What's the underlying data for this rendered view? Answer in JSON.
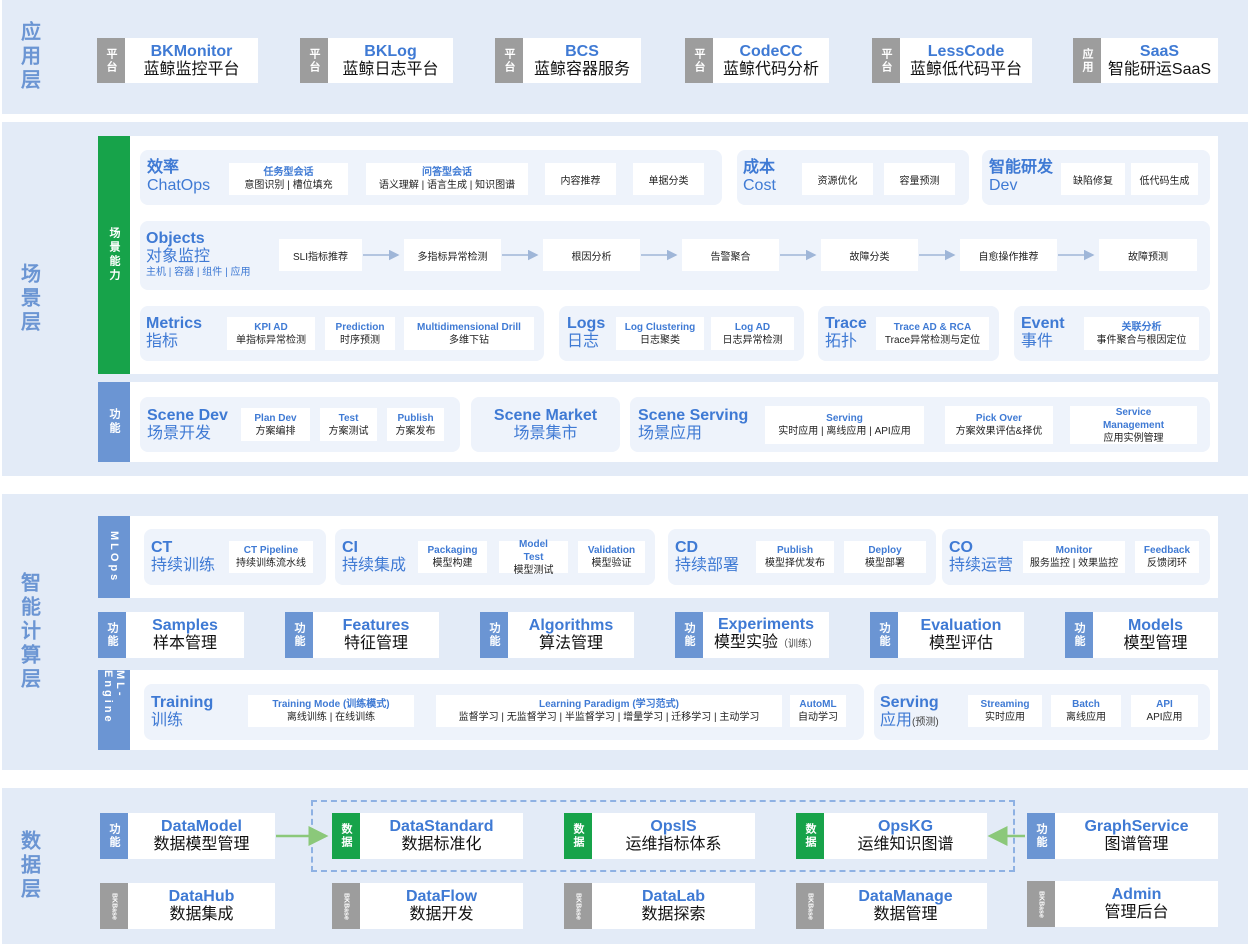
{
  "layers": {
    "app": "应用层",
    "scene": "场景层",
    "ai": "智能计算层",
    "data": "数据层"
  },
  "app_cards": [
    {
      "tag": "平台",
      "en": "BKMonitor",
      "zh": "蓝鲸监控平台"
    },
    {
      "tag": "平台",
      "en": "BKLog",
      "zh": "蓝鲸日志平台"
    },
    {
      "tag": "平台",
      "en": "BCS",
      "zh": "蓝鲸容器服务"
    },
    {
      "tag": "平台",
      "en": "CodeCC",
      "zh": "蓝鲸代码分析"
    },
    {
      "tag": "平台",
      "en": "LessCode",
      "zh": "蓝鲸低代码平台"
    },
    {
      "tag": "应用",
      "en": "SaaS",
      "zh": "智能研运SaaS"
    }
  ],
  "scene": {
    "sidebar_top": "场景能力",
    "sidebar_bottom": "功能",
    "efficiency": {
      "title_zh": "效率",
      "title_en": "ChatOps",
      "items": [
        {
          "t1": "任务型会话",
          "t2": "意图识别 | 槽位填充"
        },
        {
          "t1": "问答型会话",
          "t2": "语义理解 | 语言生成 | 知识图谱"
        },
        {
          "one": "内容推荐"
        },
        {
          "one": "单据分类"
        }
      ]
    },
    "cost": {
      "title_zh": "成本",
      "title_en": "Cost",
      "items": [
        "资源优化",
        "容量预测"
      ]
    },
    "dev": {
      "title_zh": "智能研发",
      "title_en": "Dev",
      "items": [
        "缺陷修复",
        "低代码生成"
      ]
    },
    "objects": {
      "title_en": "Objects",
      "title_zh": "对象监控",
      "sub": "主机 | 容器 | 组件 | 应用",
      "steps": [
        "SLI指标推荐",
        "多指标异常检测",
        "根因分析",
        "告警聚合",
        "故障分类",
        "自愈操作推荐",
        "故障预测"
      ]
    },
    "metrics": {
      "title_en": "Metrics",
      "title_zh": "指标",
      "items": [
        {
          "t1": "KPI AD",
          "t2": "单指标异常检测"
        },
        {
          "t1": "Prediction",
          "t2": "时序预测"
        },
        {
          "t1": "Multidimensional Drill",
          "t2": "多维下钻"
        }
      ]
    },
    "logs": {
      "title_en": "Logs",
      "title_zh": "日志",
      "items": [
        {
          "t1": "Log Clustering",
          "t2": "日志聚类"
        },
        {
          "t1": "Log AD",
          "t2": "日志异常检测"
        }
      ]
    },
    "trace": {
      "title_en": "Trace",
      "title_zh": "拓扑",
      "item": {
        "t1": "Trace AD & RCA",
        "t2": "Trace异常检测与定位"
      }
    },
    "event": {
      "title_en": "Event",
      "title_zh": "事件",
      "item": {
        "t1": "关联分析",
        "t2": "事件聚合与根因定位"
      }
    },
    "scene_dev": {
      "title_en": "Scene Dev",
      "title_zh": "场景开发",
      "items": [
        {
          "t1": "Plan Dev",
          "t2": "方案编排"
        },
        {
          "t1": "Test",
          "t2": "方案测试"
        },
        {
          "t1": "Publish",
          "t2": "方案发布"
        }
      ]
    },
    "scene_market": {
      "title_en": "Scene Market",
      "title_zh": "场景集市"
    },
    "scene_serving": {
      "title_en": "Scene Serving",
      "title_zh": "场景应用",
      "items": [
        {
          "t1": "Serving",
          "t2": "实时应用 | 离线应用 | API应用"
        },
        {
          "t1": "Pick Over",
          "t2": "方案效果评估&择优"
        },
        {
          "t1": "Service Management",
          "t2": "应用实例管理"
        }
      ]
    }
  },
  "ai": {
    "sidebar_mlops": "MLOps",
    "sidebar_func": "功能",
    "sidebar_engine": "ML-Engine",
    "ct": {
      "title_en": "CT",
      "title_zh": "持续训练",
      "items": [
        {
          "t1": "CT Pipeline",
          "t2": "持续训练流水线"
        }
      ]
    },
    "ci": {
      "title_en": "CI",
      "title_zh": "持续集成",
      "items": [
        {
          "t1": "Packaging",
          "t2": "模型构建"
        },
        {
          "t1": "Model Test",
          "t2": "模型测试"
        },
        {
          "t1": "Validation",
          "t2": "模型验证"
        }
      ]
    },
    "cd": {
      "title_en": "CD",
      "title_zh": "持续部署",
      "items": [
        {
          "t1": "Publish",
          "t2": "模型择优发布"
        },
        {
          "t1": "Deploy",
          "t2": "模型部署"
        }
      ]
    },
    "co": {
      "title_en": "CO",
      "title_zh": "持续运营",
      "items": [
        {
          "t1": "Monitor",
          "t2": "服务监控 | 效果监控"
        },
        {
          "t1": "Feedback",
          "t2": "反馈闭环"
        }
      ]
    },
    "func_cards": [
      {
        "tag": "功能",
        "en": "Samples",
        "zh": "样本管理",
        "note": ""
      },
      {
        "tag": "功能",
        "en": "Features",
        "zh": "特征管理",
        "note": ""
      },
      {
        "tag": "功能",
        "en": "Algorithms",
        "zh": "算法管理",
        "note": ""
      },
      {
        "tag": "功能",
        "en": "Experiments",
        "zh": "模型实验",
        "note": "（训练）"
      },
      {
        "tag": "功能",
        "en": "Evaluation",
        "zh": "模型评估",
        "note": ""
      },
      {
        "tag": "功能",
        "en": "Models",
        "zh": "模型管理",
        "note": ""
      }
    ],
    "training": {
      "title_en": "Training",
      "title_zh": "训练",
      "items": [
        {
          "t1": "Training Mode (训练模式)",
          "t2": "离线训练 | 在线训练"
        },
        {
          "t1": "Learning Paradigm (学习范式)",
          "t2": "监督学习 | 无监督学习 | 半监督学习 | 增量学习 | 迁移学习 | 主动学习"
        },
        {
          "t1": "AutoML",
          "t2": "自动学习"
        }
      ]
    },
    "serving": {
      "title_en": "Serving",
      "title_zh": "应用",
      "note": "(预测)",
      "items": [
        {
          "t1": "Streaming",
          "t2": "实时应用"
        },
        {
          "t1": "Batch",
          "t2": "离线应用"
        },
        {
          "t1": "API",
          "t2": "API应用"
        }
      ]
    }
  },
  "data_layer": {
    "row1": [
      {
        "tag": "功能",
        "en": "DataModel",
        "zh": "数据模型管理"
      },
      {
        "tag": "数据",
        "en": "DataStandard",
        "zh": "数据标准化"
      },
      {
        "tag": "数据",
        "en": "OpsIS",
        "zh": "运维指标体系"
      },
      {
        "tag": "数据",
        "en": "OpsKG",
        "zh": "运维知识图谱"
      },
      {
        "tag": "功能",
        "en": "GraphService",
        "zh": "图谱管理"
      }
    ],
    "row2": [
      {
        "tag": "BKBase",
        "en": "DataHub",
        "zh": "数据集成"
      },
      {
        "tag": "BKBase",
        "en": "DataFlow",
        "zh": "数据开发"
      },
      {
        "tag": "BKBase",
        "en": "DataLab",
        "zh": "数据探索"
      },
      {
        "tag": "BKBase",
        "en": "DataManage",
        "zh": "数据管理"
      },
      {
        "tag": "BKBase",
        "en": "Admin",
        "zh": "管理后台"
      }
    ]
  },
  "colors": {
    "layer_bg": "#e3ebf7",
    "accent_blue": "#3f7ad4",
    "tag_blue": "#6b95d3",
    "tag_gray": "#9d9d9d",
    "tag_green": "#17a34a",
    "arrow_green": "#8bc87a"
  }
}
